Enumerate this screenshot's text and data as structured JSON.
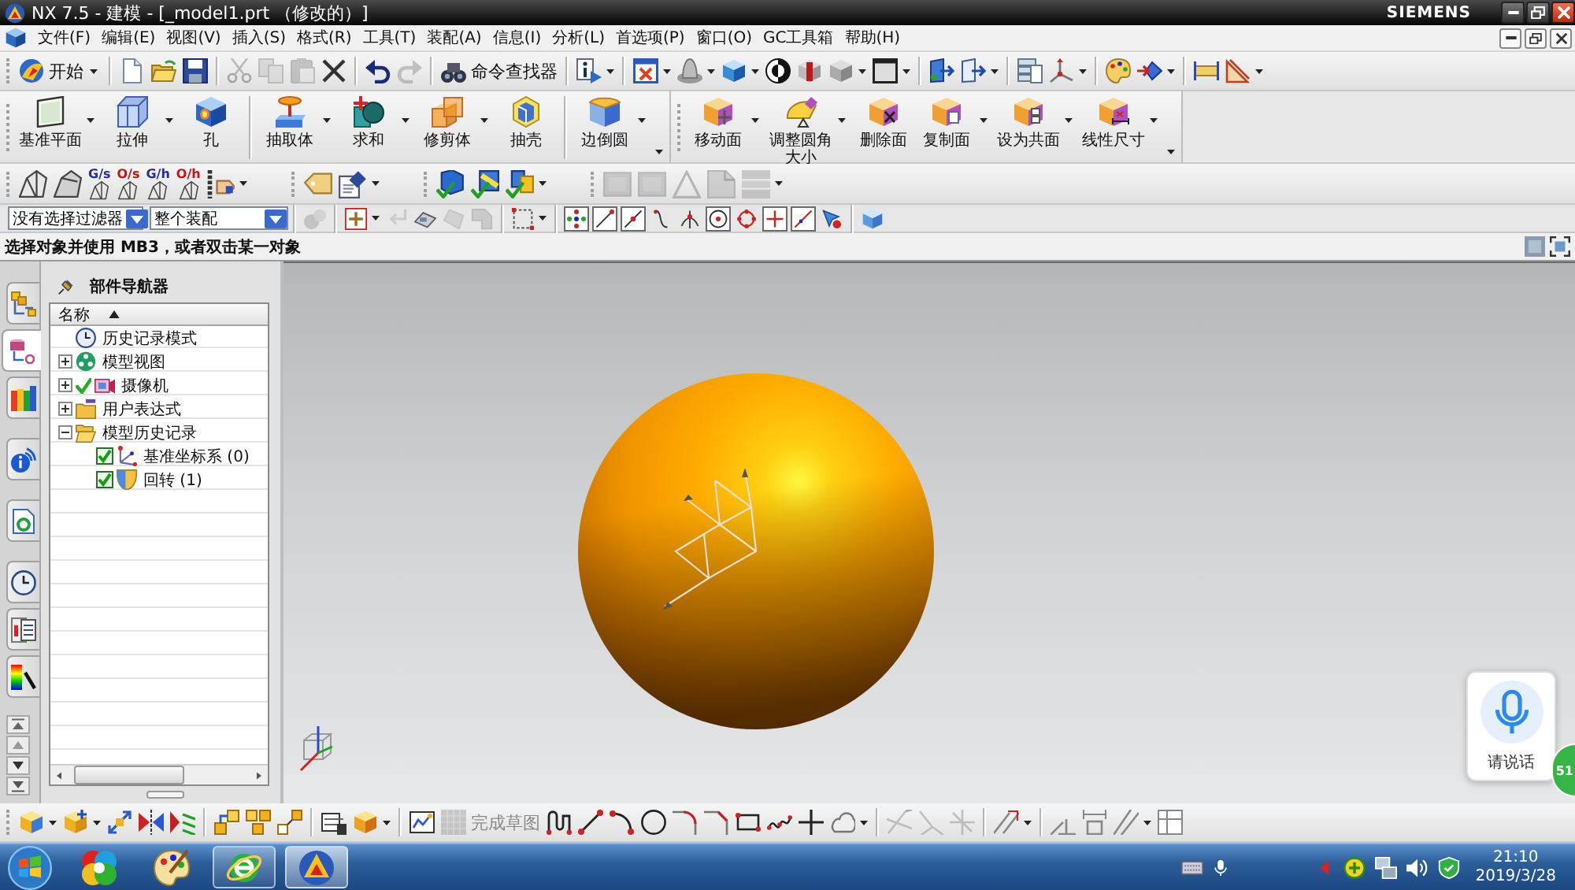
{
  "window": {
    "title": "NX 7.5 - 建模 - [_model1.prt （修改的）]",
    "brand": "SIEMENS"
  },
  "menu_bar": [
    "文件(F)",
    "编辑(E)",
    "视图(V)",
    "插入(S)",
    "格式(R)",
    "工具(T)",
    "装配(A)",
    "信息(I)",
    "分析(L)",
    "首选项(P)",
    "窗口(O)",
    "GC工具箱",
    "帮助(H)"
  ],
  "standard_toolbar": [
    {
      "label": "开始",
      "disabled": false
    },
    {
      "disabled": false
    },
    {
      "disabled": false
    },
    {
      "disabled": false
    },
    {
      "disabled": true
    },
    {
      "disabled": true
    },
    {
      "disabled": true
    },
    {
      "disabled": false
    },
    {
      "disabled": false
    },
    {
      "disabled": true
    },
    {
      "label": "命令查找器",
      "disabled": false
    },
    {
      "disabled": false
    },
    {
      "disabled": false
    },
    {
      "disabled": false
    },
    {
      "disabled": false
    },
    {
      "disabled": false
    },
    {
      "disabled": false
    },
    {
      "disabled": false
    },
    {
      "disabled": false
    },
    {
      "disabled": false
    },
    {
      "disabled": false
    },
    {
      "disabled": false
    },
    {
      "disabled": false
    },
    {
      "disabled": false
    },
    {
      "disabled": false
    },
    {
      "disabled": false
    },
    {
      "disabled": false
    }
  ],
  "feature_toolbar": [
    {
      "label": "基准平面"
    },
    {
      "label": "拉伸"
    },
    {
      "label": "孔"
    },
    {
      "label": "抽取体"
    },
    {
      "label": "求和"
    },
    {
      "label": "修剪体"
    },
    {
      "label": "抽壳"
    },
    {
      "label": "边倒圆"
    },
    {
      "label": "移动面"
    },
    {
      "label": "调整圆角大小"
    },
    {
      "label": "删除面"
    },
    {
      "label": "复制面"
    },
    {
      "label": "设为共面"
    },
    {
      "label": "线性尺寸"
    }
  ],
  "display_toolbar": [
    {
      "disabled": false
    },
    {
      "disabled": false
    },
    {
      "label": "G/s",
      "color": "#2a2aa0",
      "disabled": false
    },
    {
      "label": "O/s",
      "color": "#c01818",
      "disabled": false
    },
    {
      "label": "G/h",
      "color": "#2a2aa0",
      "disabled": false
    },
    {
      "label": "O/h",
      "color": "#c01818",
      "disabled": false
    },
    {
      "disabled": false
    },
    {
      "disabled": false
    },
    {
      "disabled": false
    },
    {
      "disabled": false
    },
    {
      "disabled": false
    },
    {
      "disabled": false
    },
    {
      "disabled": true
    },
    {
      "disabled": true
    },
    {
      "disabled": true
    },
    {
      "disabled": true
    },
    {
      "disabled": true
    }
  ],
  "selection_bar": {
    "type_filter": "没有选择过滤器",
    "scope": "整个装配",
    "tools": [
      {
        "disabled": true
      },
      {
        "disabled": false
      },
      {
        "disabled": true
      },
      {
        "disabled": false
      },
      {
        "disabled": true
      },
      {
        "disabled": true
      },
      {
        "disabled": false
      }
    ],
    "snap_points": [
      {
        "on": true
      },
      {
        "on": true
      },
      {
        "on": true
      },
      {
        "on": false
      },
      {
        "on": false
      },
      {
        "on": true
      },
      {
        "on": false
      },
      {
        "on": true
      },
      {
        "on": true
      },
      {
        "on": false
      }
    ]
  },
  "status_line": "选择对象并使用 MB3，或者双击某一对象",
  "resource_bar": [
    {
      "selected": false
    },
    {
      "selected": true
    },
    {
      "selected": false
    },
    {
      "selected": false
    },
    {
      "selected": false
    },
    {
      "selected": false
    },
    {
      "selected": false
    },
    {
      "selected": false
    }
  ],
  "part_navigator": {
    "title": "部件导航器",
    "column": "名称",
    "sorted_ascending": true,
    "rows": [
      {
        "kind": "leaf",
        "label": "历史记录模式",
        "checked": false
      },
      {
        "kind": "group",
        "label": "模型视图",
        "expanded": false,
        "checked": false
      },
      {
        "kind": "group",
        "label": "摄像机",
        "expanded": false,
        "checked": true
      },
      {
        "kind": "group",
        "label": "用户表达式",
        "expanded": false,
        "checked": false
      },
      {
        "kind": "group",
        "label": "模型历史记录",
        "expanded": true,
        "checked": false,
        "children": [
          {
            "kind": "feature",
            "label": "基准坐标系 (0)",
            "checked": true
          },
          {
            "kind": "feature",
            "label": "回转 (1)",
            "checked": true
          }
        ]
      }
    ]
  },
  "sketch_toolbar": [
    {
      "disabled": false
    },
    {
      "disabled": false
    },
    {
      "disabled": false
    },
    {
      "disabled": false
    },
    {
      "disabled": false
    },
    {
      "disabled": false
    },
    {
      "disabled": false
    },
    {
      "disabled": false
    },
    {
      "disabled": false
    },
    {
      "disabled": false
    },
    {
      "disabled": false
    },
    {
      "label": "完成草图",
      "disabled": true
    },
    {
      "disabled": false
    },
    {
      "disabled": false
    },
    {
      "disabled": false
    },
    {
      "disabled": false
    },
    {
      "disabled": false
    },
    {
      "disabled": false
    },
    {
      "disabled": false
    },
    {
      "disabled": false
    },
    {
      "disabled": false
    },
    {
      "disabled": false
    },
    {
      "disabled": true
    },
    {
      "disabled": true
    },
    {
      "disabled": true
    },
    {
      "disabled": false
    },
    {
      "disabled": false
    },
    {
      "disabled": false
    },
    {
      "disabled": false
    },
    {
      "disabled": false
    }
  ],
  "voice_button": {
    "label": "请说话"
  },
  "notification_badge": {
    "count": "51"
  },
  "taskbar": {
    "apps": [
      {
        "open": false,
        "selected": false
      },
      {
        "open": false,
        "selected": false
      },
      {
        "open": true,
        "selected": false
      },
      {
        "open": true,
        "selected": true
      }
    ],
    "time": "21:10",
    "date": "2019/3/28"
  }
}
